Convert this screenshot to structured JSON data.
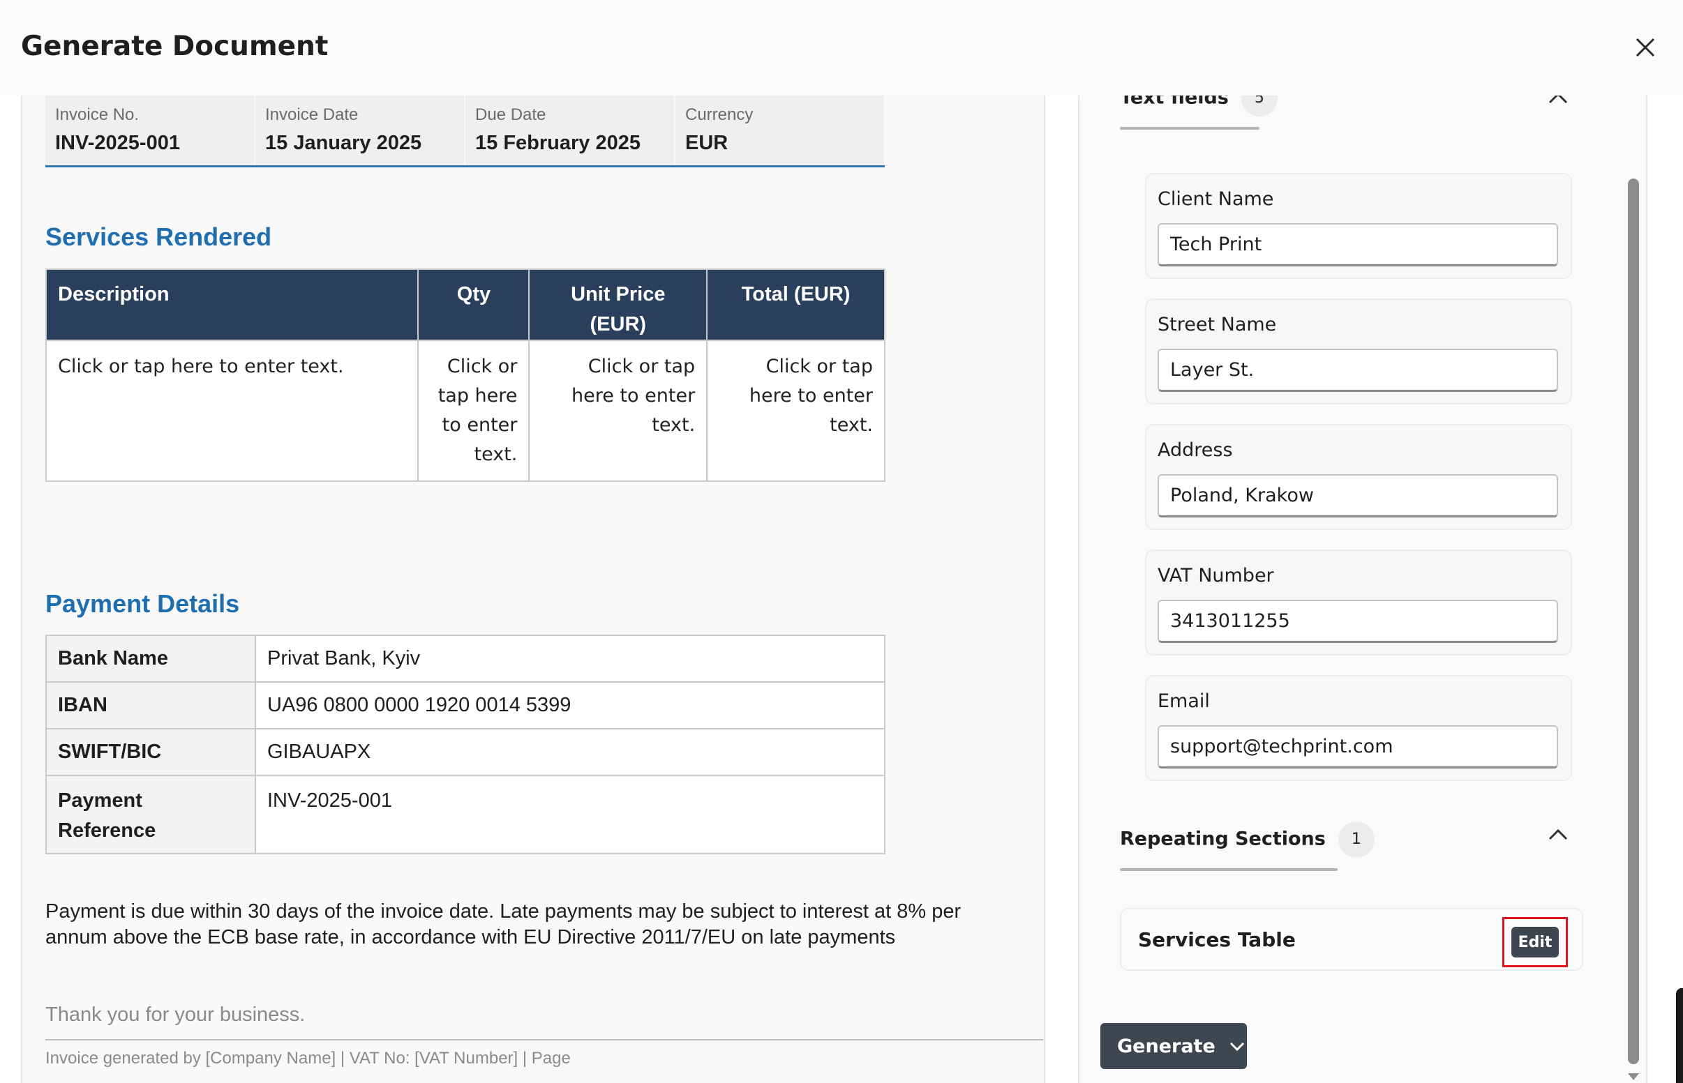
{
  "modal": {
    "title": "Generate Document"
  },
  "document": {
    "meta": [
      {
        "label": "Invoice No.",
        "value": "INV-2025-001"
      },
      {
        "label": "Invoice Date",
        "value": "15 January 2025"
      },
      {
        "label": "Due Date",
        "value": "15 February 2025"
      },
      {
        "label": "Currency",
        "value": "EUR"
      }
    ],
    "services_title": "Services Rendered",
    "services_headers": [
      "Description",
      "Qty",
      "Unit Price (EUR)",
      "Total (EUR)"
    ],
    "services_row": [
      "Click or tap here to enter text.",
      "Click or tap here to enter text.",
      "Click or tap here to enter text.",
      "Click or tap here to enter text."
    ],
    "payment_title": "Payment Details",
    "payment_rows": [
      {
        "key": "Bank Name",
        "value": "Privat Bank, Kyiv"
      },
      {
        "key": "IBAN",
        "value": "UA96 0800 0000 1920 0014 5399"
      },
      {
        "key": "SWIFT/BIC",
        "value": "GIBAUAPX"
      },
      {
        "key": "Payment Reference",
        "value": "INV-2025-001"
      }
    ],
    "note": "Payment is due within 30 days of the invoice date. Late payments may be subject to interest at 8% per annum above the ECB base rate, in accordance with EU Directive 2011/7/EU on late payments",
    "thanks": "Thank you for your business.",
    "footer": "Invoice generated by [Company Name]  |  VAT No: [VAT Number]  |  Page"
  },
  "sidebar": {
    "text_fields": {
      "label": "Text fields",
      "count": "5"
    },
    "fields": [
      {
        "label": "Client Name",
        "value": "Tech Print"
      },
      {
        "label": "Street Name",
        "value": "Layer St."
      },
      {
        "label": "Address",
        "value": "Poland, Krakow"
      },
      {
        "label": "VAT Number",
        "value": "3413011255"
      },
      {
        "label": "Email",
        "value": "support@techprint.com"
      }
    ],
    "repeating": {
      "label": "Repeating Sections",
      "count": "1"
    },
    "services_table": {
      "label": "Services Table",
      "edit": "Edit"
    },
    "generate": "Generate"
  }
}
